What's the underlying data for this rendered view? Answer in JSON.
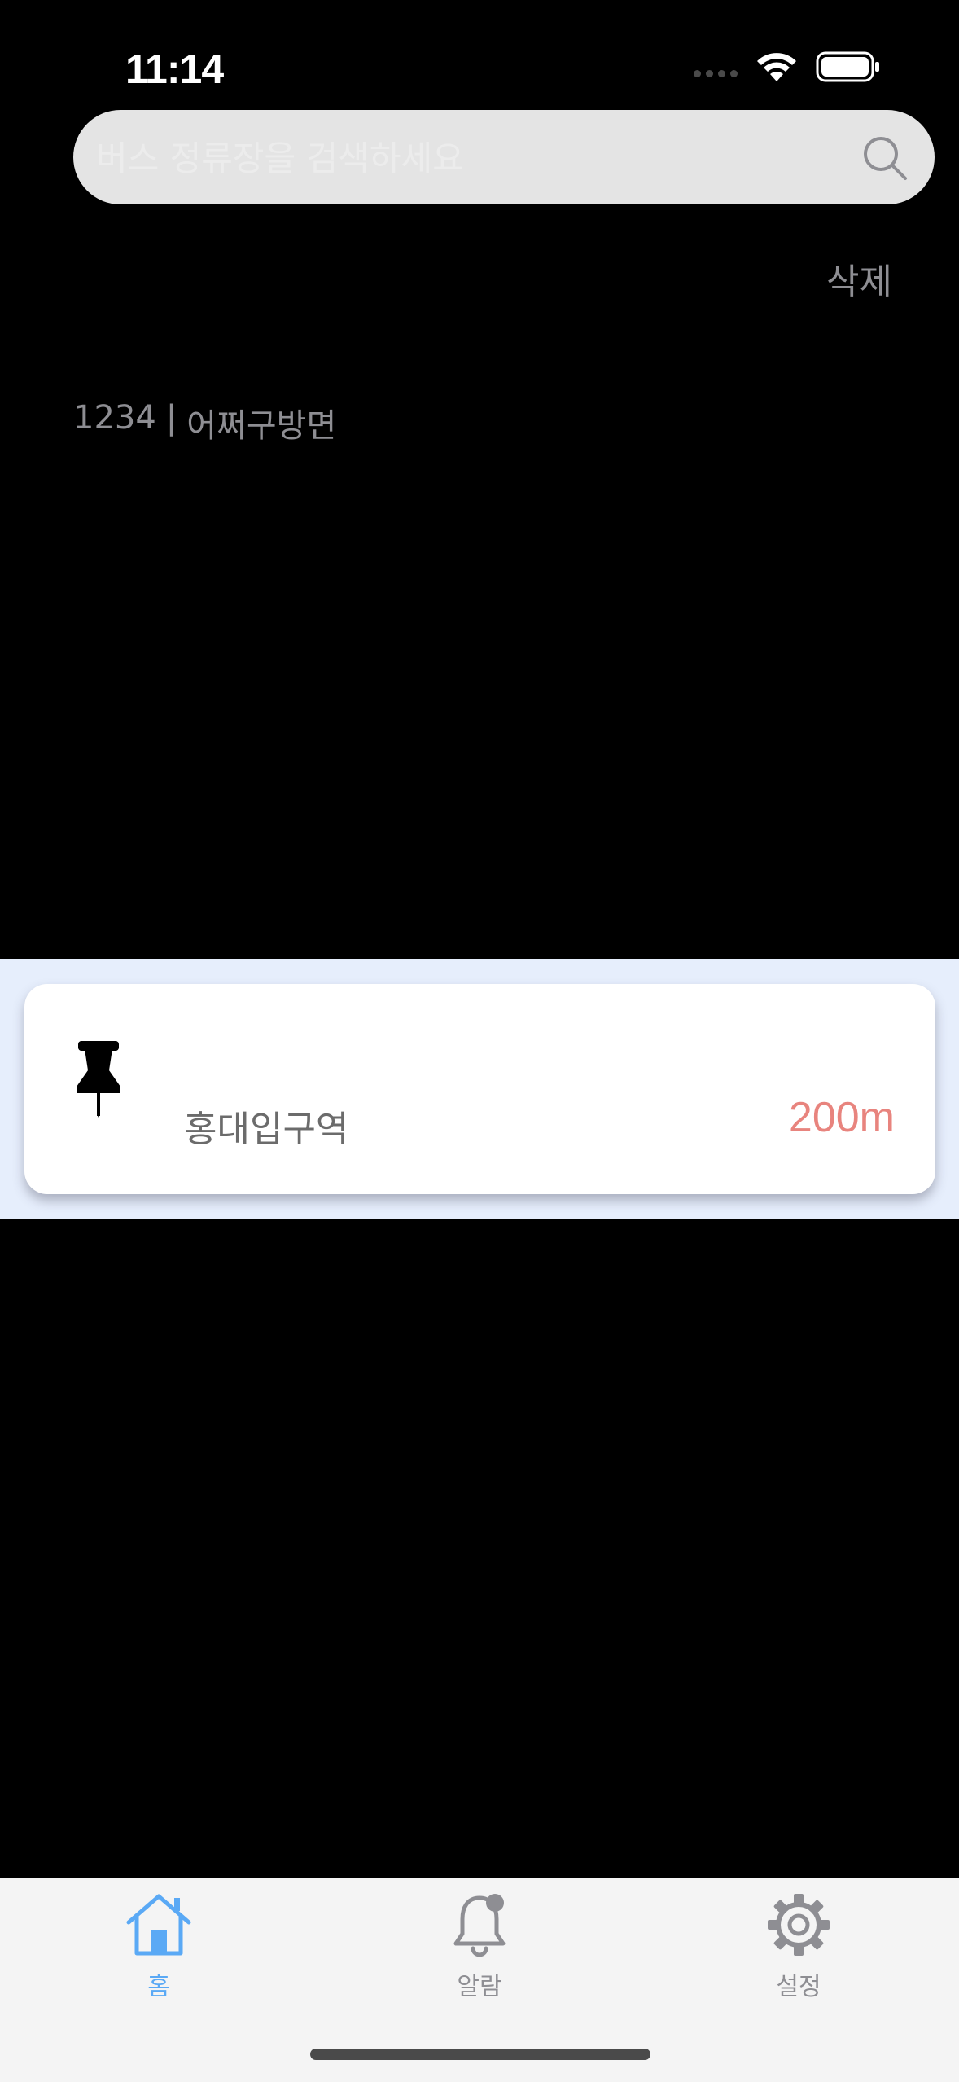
{
  "status_bar": {
    "time": "11:14"
  },
  "search": {
    "placeholder": "버스 정류장을 검색하세요",
    "icon": "search-icon"
  },
  "actions": {
    "delete_label": "삭제"
  },
  "recent": {
    "stop_number": "1234",
    "separator": "|",
    "direction": "어쩌구방면"
  },
  "place_card": {
    "icon": "pushpin-icon",
    "name": "홍대입구역",
    "distance": "200m"
  },
  "tab_bar": {
    "selected": "home",
    "tabs": [
      {
        "id": "home",
        "label": "홈",
        "icon": "house-icon"
      },
      {
        "id": "alarm",
        "label": "알람",
        "icon": "bell-icon"
      },
      {
        "id": "settings",
        "label": "설정",
        "icon": "gear-icon"
      }
    ]
  },
  "colors": {
    "background": "#000000",
    "accent": "#5aa9f5",
    "distance": "#e8847e",
    "muted_text": "#8e8e93",
    "card_band": "#e6eefc",
    "tab_bar": "#f4f4f4"
  }
}
